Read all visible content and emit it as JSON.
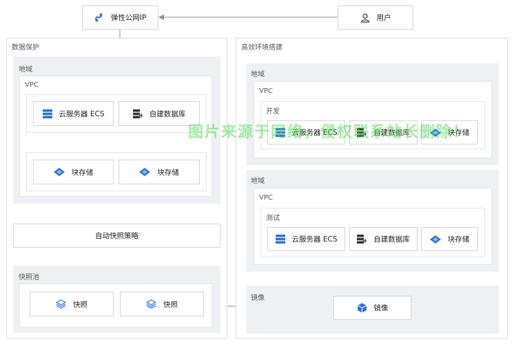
{
  "colors": {
    "accent": "#2b6fe6",
    "border": "#cfd4db",
    "zone": "#eef0f3",
    "arrow": "#8a8f96",
    "watermark": "#48d448"
  },
  "top": {
    "eip": "弹性公网IP",
    "user": "用户"
  },
  "left": {
    "title": "数据保护",
    "region": "地域",
    "vpc": "VPC",
    "ecs": "云服务器 ECS",
    "db": "自建数据库",
    "storage1": "块存储",
    "storage2": "块存储",
    "policy": "自动快照策略",
    "pool": "快照池",
    "snap1": "快照",
    "snap2": "快照"
  },
  "right": {
    "title": "高效环境搭建",
    "region1": "地域",
    "vpc1": "VPC",
    "dev": "开发",
    "ecs1": "云服务器 ECS",
    "db1": "自建数据库",
    "storage1": "块存储",
    "region2": "地域",
    "vpc2": "VPC",
    "test": "测试",
    "ecs2": "云服务器 ECS",
    "db2": "自建数据库",
    "storage2": "块存储",
    "image_zone": "镜像",
    "image": "镜像"
  },
  "watermark": "图片来源于网络，侵权联系站长删除！"
}
